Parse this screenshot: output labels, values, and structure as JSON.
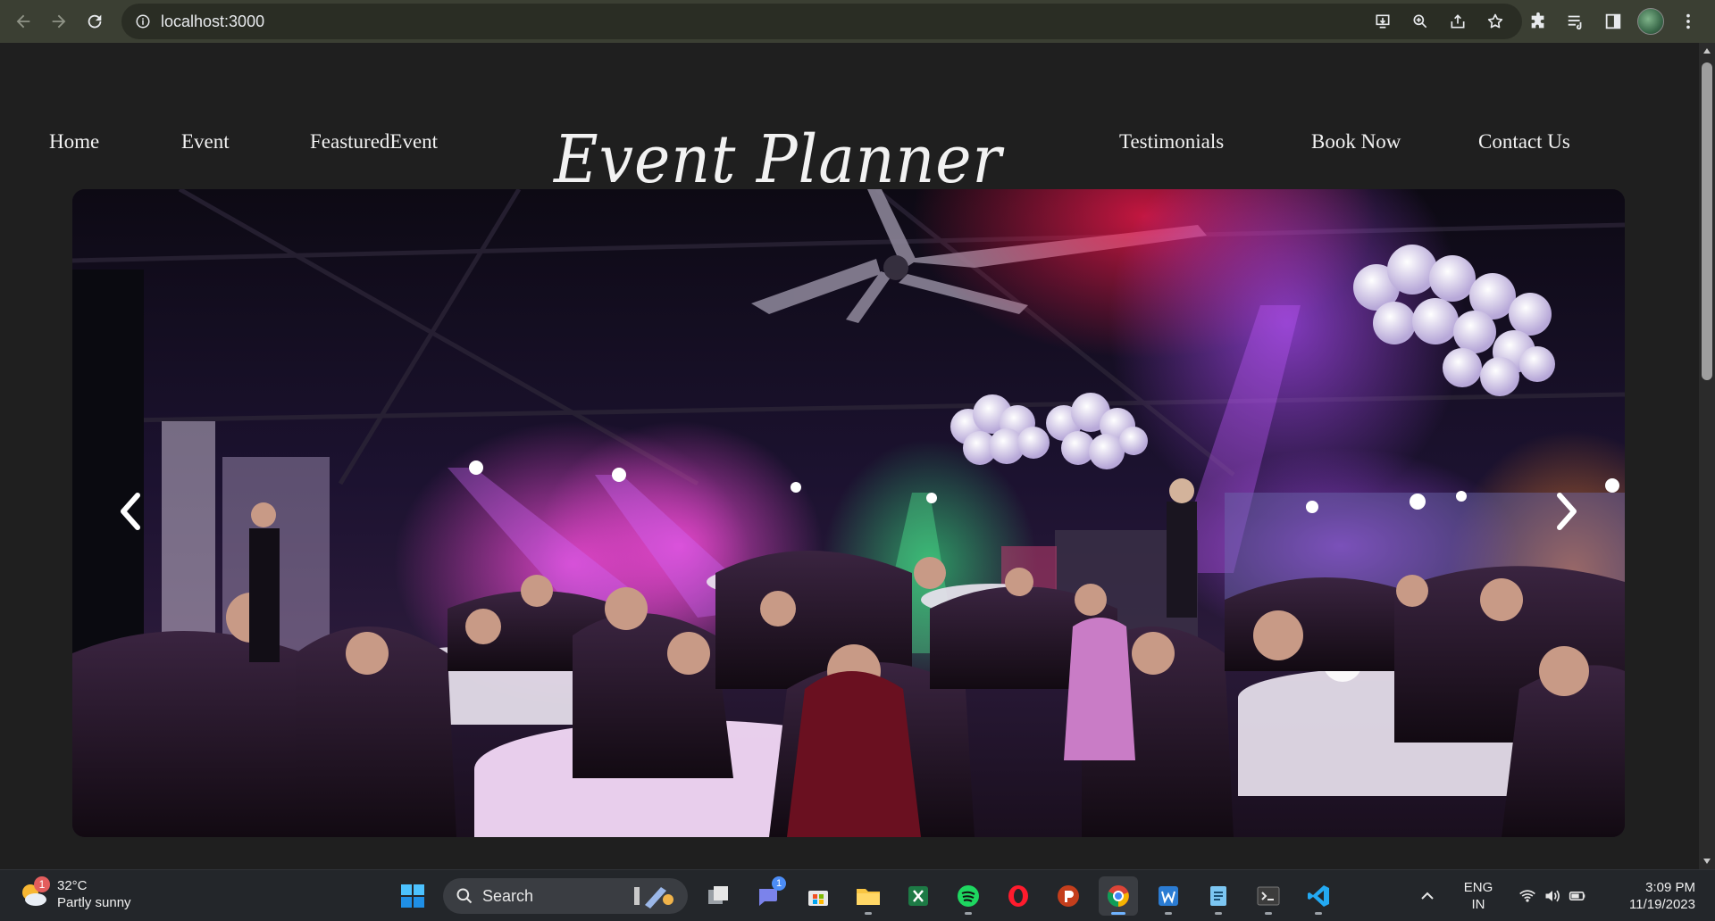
{
  "browser": {
    "url": "localhost:3000",
    "icons": {
      "back": "arrow-left-icon",
      "forward": "arrow-right-icon",
      "reload": "reload-icon",
      "site_info": "info-icon",
      "install": "install-app-icon",
      "zoom": "zoom-icon",
      "share": "share-icon",
      "bookmark": "star-icon",
      "extensions": "puzzle-icon",
      "media": "media-queue-icon",
      "side_panel": "side-panel-icon",
      "menu": "kebab-menu-icon"
    }
  },
  "site": {
    "brand": "Event Planner",
    "nav_left": [
      "Home",
      "Event",
      "FeasturedEvent"
    ],
    "nav_right": [
      "Testimonials",
      "Book Now",
      "Contact Us"
    ],
    "colors": {
      "background": "#1f1f1f",
      "text": "#f2f2f2"
    }
  },
  "carousel": {
    "slide_description_icon": "event-photo",
    "prev_icon": "chevron-left-icon",
    "next_icon": "chevron-right-icon"
  },
  "taskbar": {
    "weather": {
      "temp": "32°C",
      "condition": "Partly sunny",
      "badge": "1"
    },
    "search_label": "Search",
    "apps": [
      {
        "name": "task-view-icon"
      },
      {
        "name": "teams-chat-icon",
        "badge": "1"
      },
      {
        "name": "microsoft-store-icon"
      },
      {
        "name": "file-explorer-icon"
      },
      {
        "name": "excel-icon"
      },
      {
        "name": "spotify-icon"
      },
      {
        "name": "opera-icon"
      },
      {
        "name": "powerpoint-icon"
      },
      {
        "name": "chrome-icon"
      },
      {
        "name": "word-icon"
      },
      {
        "name": "notepad-icon"
      },
      {
        "name": "terminal-icon"
      },
      {
        "name": "vscode-icon"
      }
    ],
    "language": {
      "line1": "ENG",
      "line2": "IN"
    },
    "clock": {
      "time": "3:09 PM",
      "date": "11/19/2023"
    }
  }
}
